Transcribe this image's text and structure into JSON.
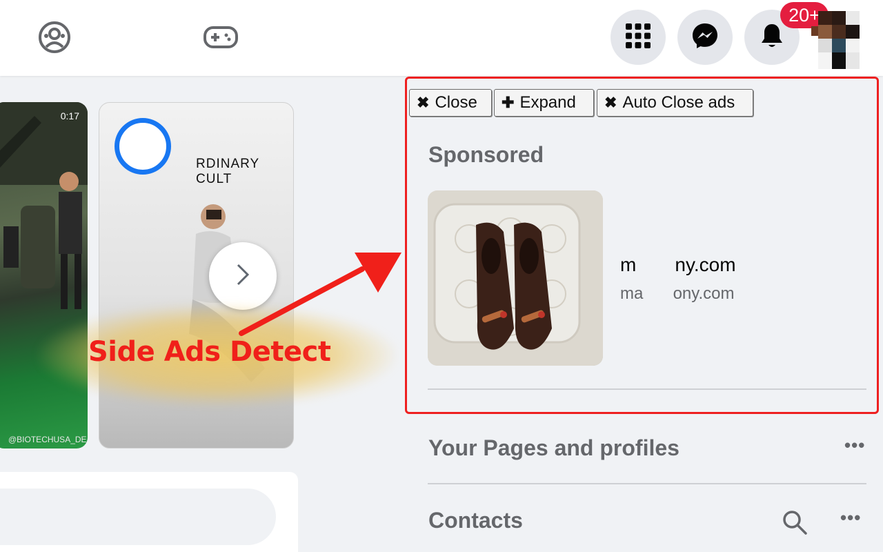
{
  "topbar": {
    "icons": [
      "groups-icon",
      "gaming-icon",
      "menu-grid-icon",
      "messenger-icon",
      "bell-icon"
    ],
    "notification_badge": "20+"
  },
  "stories": {
    "first": {
      "duration": "0:17",
      "handle": "@BIOTECHUSA_DE"
    },
    "second": {
      "brand_text": "RDINARY CULT"
    }
  },
  "annotation": {
    "label": "Side Ads Detect",
    "color": "#f0201a"
  },
  "ad_toolbar": {
    "close_label": "Close",
    "expand_label": "Expand",
    "auto_close_label": "Auto Close ads"
  },
  "sidebar": {
    "sponsored_title": "Sponsored",
    "ad": {
      "title": "m          ny.com",
      "domain": "ma         ony.com"
    },
    "pages_title": "Your Pages and profiles",
    "contacts_title": "Contacts"
  },
  "colors": {
    "accent": "#1877f2",
    "badge": "#e41e3f",
    "highlight_box": "#ee2020"
  }
}
